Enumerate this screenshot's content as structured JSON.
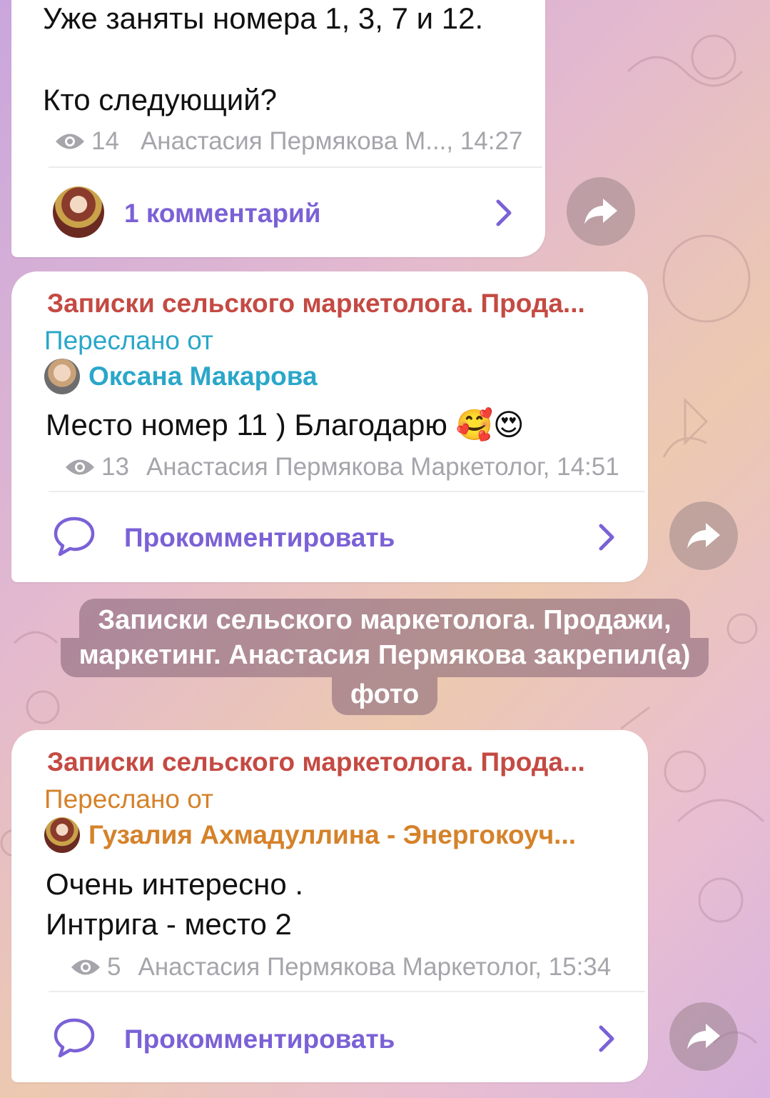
{
  "messages": [
    {
      "text_lines": [
        "Уже заняты номера 1, 3, 7 и 12.",
        "",
        "Кто следующий?"
      ],
      "views": "14",
      "author_time": "Анастасия Пермякова М..., 14:27",
      "comments_label": "1 комментарий"
    },
    {
      "channel": "Записки сельского маркетолога. Прода...",
      "forwarded_label": "Переслано от",
      "forwarded_from": "Оксана Макарова",
      "text": "Место номер 11 ) Благодарю 🥰😍",
      "views": "13",
      "author_time": "Анастасия Пермякова Маркетолог, 14:51",
      "comments_label": "Прокомментировать"
    },
    {
      "channel": "Записки сельского маркетолога. Прода...",
      "forwarded_label": "Переслано от",
      "forwarded_from": "Гузалия Ахмадуллина - Энергокоуч...",
      "text_lines": [
        "Очень интересно .",
        "Интрига - место 2"
      ],
      "views": "5",
      "author_time": "Анастасия Пермякова Маркетолог, 15:34",
      "comments_label": "Прокомментировать"
    }
  ],
  "service_message": {
    "line1": "Записки сельского маркетолога. Продажи,",
    "line2": "маркетинг. Анастасия Пермякова закрепил(а)",
    "line3": "фото"
  },
  "colors": {
    "channel_name": "#c44a43",
    "forward_blue": "#2aa7c9",
    "forward_orange": "#d5822a",
    "comment_accent": "#7b61d6",
    "meta_gray": "#a5a5ab"
  },
  "icons": [
    "eye-icon",
    "share-icon",
    "chevron-right-icon",
    "comment-bubble-icon"
  ]
}
